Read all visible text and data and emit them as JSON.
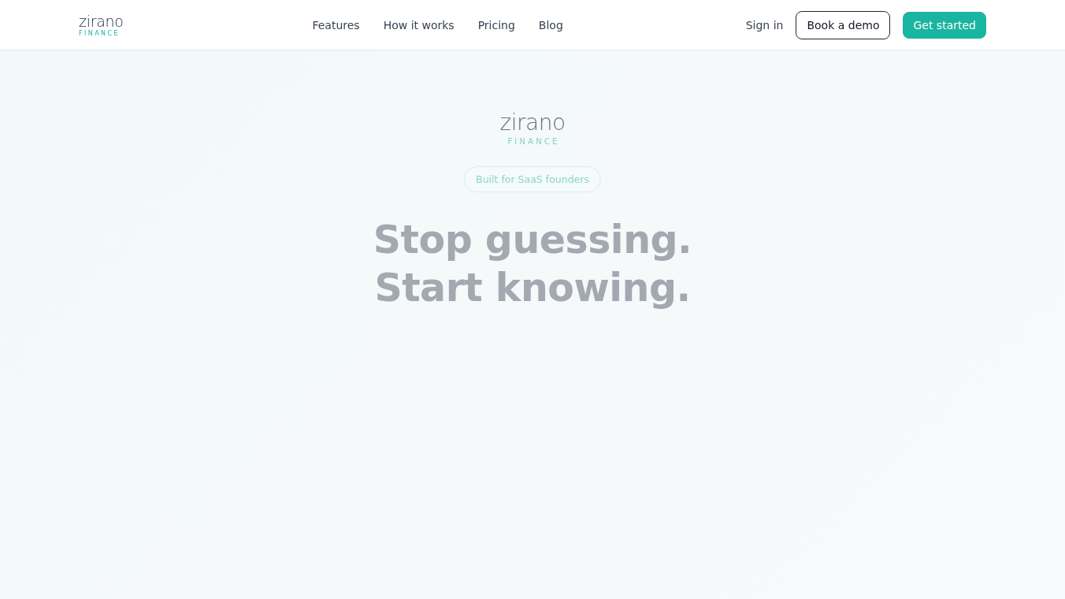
{
  "nav": {
    "logo": {
      "wordmark": "zirano",
      "tagline": "FINANCE"
    },
    "links": [
      "Features",
      "How it works",
      "Pricing",
      "Blog"
    ],
    "sign_in": "Sign in",
    "buttons": [
      {
        "label": "Book a demo",
        "kind": "outline"
      },
      {
        "label": "Get started",
        "kind": "primary"
      }
    ]
  },
  "hero": {
    "logo": {
      "wordmark": "zirano",
      "tagline": "FINANCE"
    },
    "badge": "Built for SaaS founders",
    "headline": [
      "Stop guessing.",
      "Start knowing."
    ]
  }
}
